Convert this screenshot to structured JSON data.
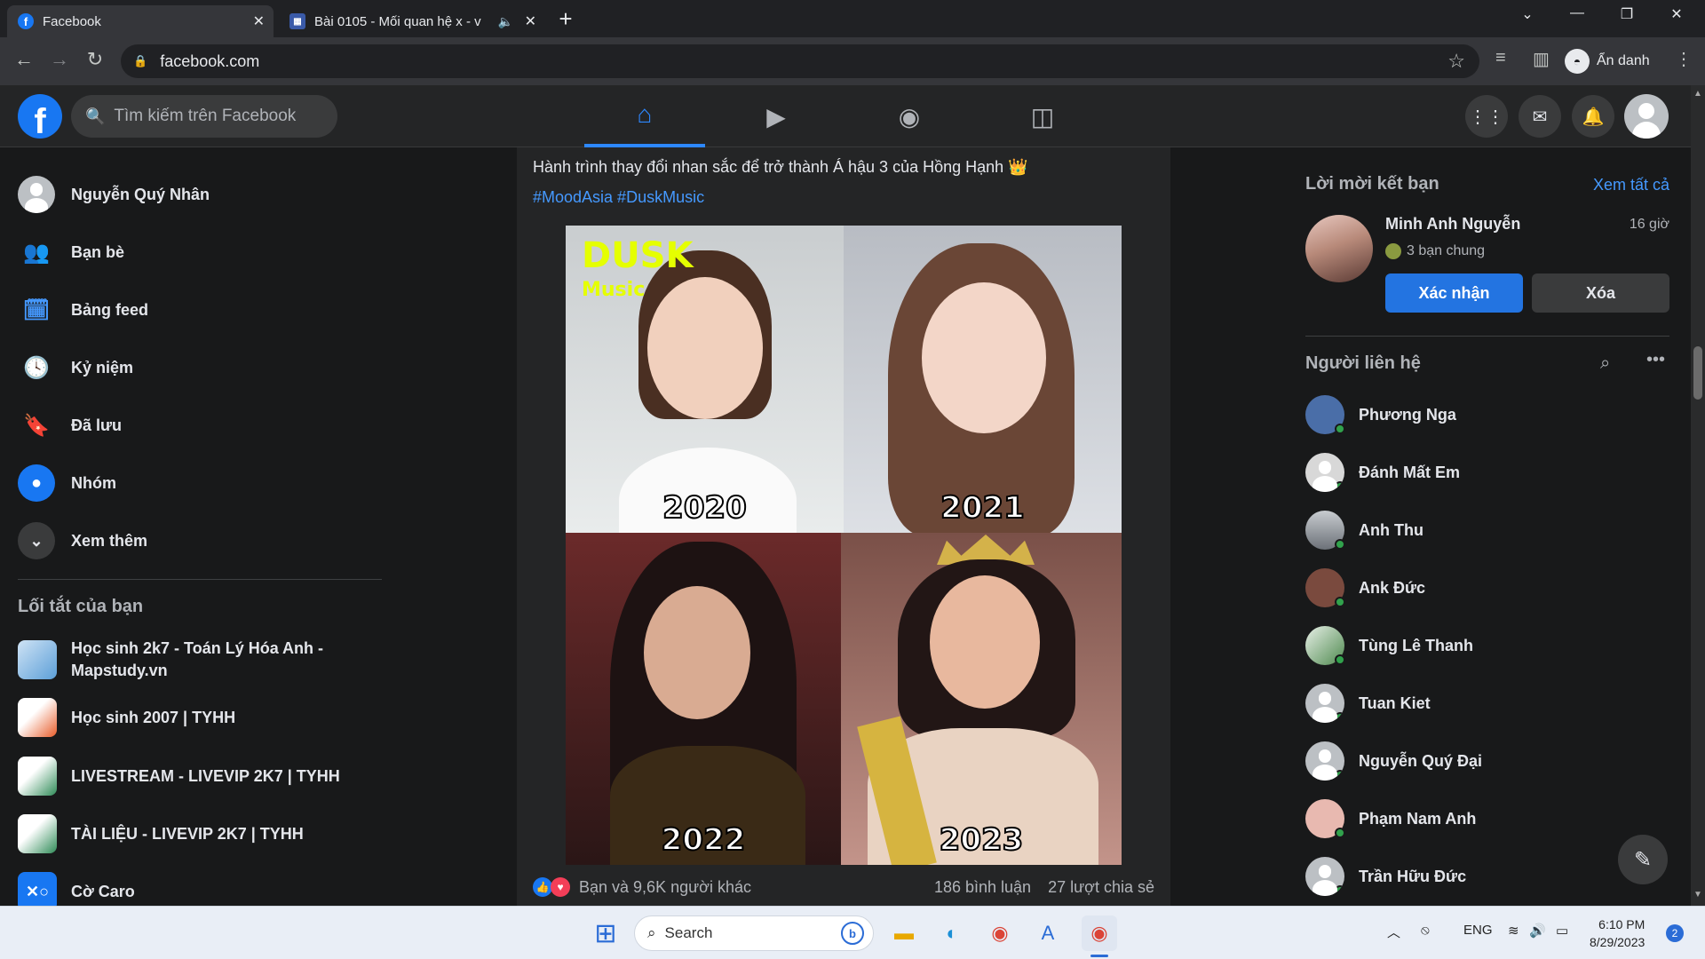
{
  "browser": {
    "tabs": [
      {
        "title": "Facebook",
        "active": true
      },
      {
        "title": "Bài 0105 - Mối quan hệ x - v",
        "active": false
      }
    ],
    "address": "facebook.com",
    "incognito_label": "Ẩn danh"
  },
  "header": {
    "search_placeholder": "Tìm kiếm trên Facebook"
  },
  "left_nav": {
    "profile_name": "Nguyễn Quý Nhân",
    "items": [
      {
        "label": "Bạn bè",
        "icon": "friends-icon"
      },
      {
        "label": "Bảng feed",
        "icon": "feed-icon"
      },
      {
        "label": "Kỷ niệm",
        "icon": "memories-icon"
      },
      {
        "label": "Đã lưu",
        "icon": "saved-icon"
      },
      {
        "label": "Nhóm",
        "icon": "groups-icon"
      },
      {
        "label": "Xem thêm",
        "icon": "chevron-down-icon"
      }
    ],
    "shortcuts_title": "Lối tắt của bạn",
    "shortcuts": [
      {
        "line1": "Học sinh 2k7 - Toán Lý Hóa Anh -",
        "line2": "Mapstudy.vn"
      },
      {
        "line1": "Học sinh 2007 | TYHH",
        "line2": ""
      },
      {
        "line1": "LIVESTREAM - LIVEVIP 2K7 | TYHH",
        "line2": ""
      },
      {
        "line1": "TÀI LIỆU - LIVEVIP 2K7 | TYHH",
        "line2": ""
      },
      {
        "line1": "Cờ Caro",
        "line2": ""
      }
    ]
  },
  "post": {
    "text": "Hành trình thay đổi nhan sắc để trở thành Á hậu 3 của Hồng Hạnh 👑",
    "tags": "#MoodAsia #DuskMusic",
    "watermark_line1": "DUSK",
    "watermark_line2": "Music",
    "years": [
      "2020",
      "2021",
      "2022",
      "2023"
    ],
    "reactions_text": "Bạn và 9,6K người khác",
    "comments": "186 bình luận",
    "shares": "27 lượt chia sẻ"
  },
  "right_col": {
    "requests_title": "Lời mời kết bạn",
    "see_all": "Xem tất cả",
    "request": {
      "name": "Minh Anh Nguyễn",
      "time": "16 giờ",
      "mutual": "3 bạn chung",
      "confirm": "Xác nhận",
      "delete": "Xóa"
    },
    "contacts_title": "Người liên hệ",
    "contacts": [
      {
        "name": "Phương Nga",
        "color": "#4a6ea8"
      },
      {
        "name": "Đánh Mất Em",
        "color": "#d8d8d8"
      },
      {
        "name": "Anh Thu",
        "color": "#9aa1a8"
      },
      {
        "name": "Ank Đức",
        "color": "#7a4a3e"
      },
      {
        "name": "Tùng Lê Thanh",
        "color": "#4f8a4f"
      },
      {
        "name": "Tuan Kiet",
        "color": "#bcc0c4"
      },
      {
        "name": "Nguyễn Quý Đại",
        "color": "#bcc0c4"
      },
      {
        "name": "Phạm Nam Anh",
        "color": "#e8b9b0"
      },
      {
        "name": "Trần Hữu Đức",
        "color": "#bcc0c4"
      }
    ]
  },
  "taskbar": {
    "search": "Search",
    "lang": "ENG",
    "time": "6:10 PM",
    "date": "8/29/2023",
    "notifications": "2"
  }
}
